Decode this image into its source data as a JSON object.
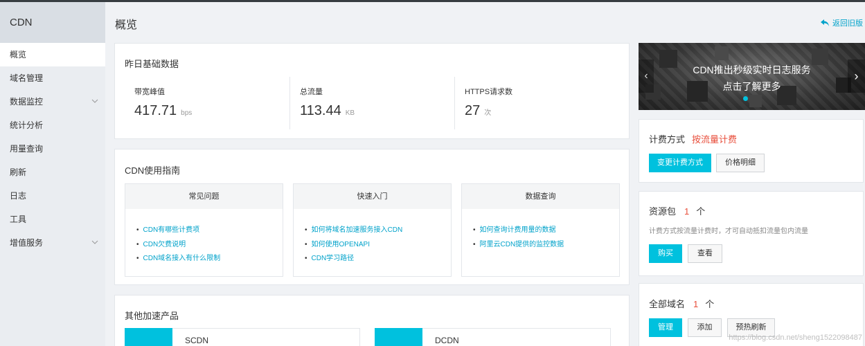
{
  "sidebar": {
    "title": "CDN",
    "items": [
      {
        "label": "概览",
        "active": true,
        "expandable": false
      },
      {
        "label": "域名管理",
        "active": false,
        "expandable": false
      },
      {
        "label": "数据监控",
        "active": false,
        "expandable": true
      },
      {
        "label": "统计分析",
        "active": false,
        "expandable": false
      },
      {
        "label": "用量查询",
        "active": false,
        "expandable": false
      },
      {
        "label": "刷新",
        "active": false,
        "expandable": false
      },
      {
        "label": "日志",
        "active": false,
        "expandable": false
      },
      {
        "label": "工具",
        "active": false,
        "expandable": false
      },
      {
        "label": "增值服务",
        "active": false,
        "expandable": true
      }
    ]
  },
  "header": {
    "title": "概览",
    "back_link": "返回旧版"
  },
  "basic_data": {
    "title": "昨日基础数据",
    "stats": [
      {
        "label": "带宽峰值",
        "value": "417.71",
        "unit": "bps"
      },
      {
        "label": "总流量",
        "value": "113.44",
        "unit": "KB"
      },
      {
        "label": "HTTPS请求数",
        "value": "27",
        "unit": "次"
      }
    ]
  },
  "guide": {
    "title": "CDN使用指南",
    "boxes": [
      {
        "head": "常见问题",
        "links": [
          "CDN有哪些计费项",
          "CDN欠费说明",
          "CDN域名接入有什么限制"
        ]
      },
      {
        "head": "快速入门",
        "links": [
          "如何将域名加速服务接入CDN",
          "如何使用OPENAPI",
          "CDN学习路径"
        ]
      },
      {
        "head": "数据查询",
        "links": [
          "如何查询计费用量的数据",
          "阿里云CDN提供的监控数据"
        ]
      }
    ]
  },
  "other_products": {
    "title": "其他加速产品",
    "items": [
      "SCDN",
      "DCDN"
    ]
  },
  "banner": {
    "line1": "CDN推出秒级实时日志服务",
    "line2": "点击了解更多"
  },
  "billing": {
    "title": "计费方式",
    "mode": "按流量计费",
    "change_button": "变更计费方式",
    "price_button": "价格明细"
  },
  "resource_pack": {
    "title": "资源包",
    "count": "1",
    "unit": "个",
    "desc": "计费方式按流量计费时，才可自动抵扣流量包内流量",
    "buy_button": "购买",
    "view_button": "查看"
  },
  "domains": {
    "title": "全部域名",
    "count": "1",
    "unit": "个",
    "manage_button": "管理",
    "add_button": "添加",
    "preheat_button": "预热刷新"
  },
  "watermark": "https://blog.csdn.net/sheng1522098487",
  "colors": {
    "accent": "#00c1de",
    "link": "#00a2ca",
    "highlight": "#e84e3b",
    "sidebar_bg": "#eaedf1"
  }
}
